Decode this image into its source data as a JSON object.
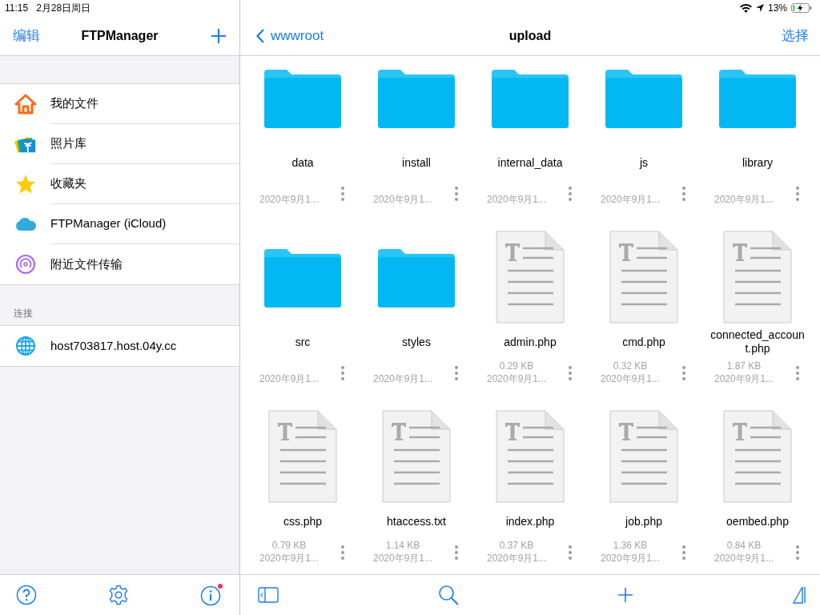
{
  "status_bar": {
    "time": "11:15",
    "date": "2月28日周日",
    "battery": {
      "text": "13%",
      "level": 0.13
    }
  },
  "sidebar": {
    "nav": {
      "edit": "编辑",
      "title": "FTPManager"
    },
    "items": [
      {
        "kind": "home",
        "label": "我的文件"
      },
      {
        "kind": "photos",
        "label": "照片库"
      },
      {
        "kind": "favorites",
        "label": "收藏夹"
      },
      {
        "kind": "cloud",
        "label": "FTPManager (iCloud)"
      },
      {
        "kind": "nearby",
        "label": "附近文件传输"
      }
    ],
    "section": "连接",
    "connections": [
      {
        "label": "host703817.host.04y.cc"
      }
    ],
    "info_notification": true
  },
  "main": {
    "nav": {
      "back": "wwwroot",
      "title": "upload",
      "select": "选择"
    },
    "files": [
      {
        "kind": "folder",
        "name": "data",
        "date": "2020年9月1..."
      },
      {
        "kind": "folder",
        "name": "install",
        "date": "2020年9月1..."
      },
      {
        "kind": "folder",
        "name": "internal_data",
        "date": "2020年9月1..."
      },
      {
        "kind": "folder",
        "name": "js",
        "date": "2020年9月1..."
      },
      {
        "kind": "folder",
        "name": "library",
        "date": "2020年9月1..."
      },
      {
        "kind": "folder",
        "name": "src",
        "date": "2020年9月1..."
      },
      {
        "kind": "folder",
        "name": "styles",
        "date": "2020年9月1..."
      },
      {
        "kind": "file",
        "name": "admin.php",
        "size": "0.29 KB",
        "date": "2020年9月1..."
      },
      {
        "kind": "file",
        "name": "cmd.php",
        "size": "0.32 KB",
        "date": "2020年9月1..."
      },
      {
        "kind": "file",
        "name": "connected_account.php",
        "size": "1.87 KB",
        "date": "2020年9月1..."
      },
      {
        "kind": "file",
        "name": "css.php",
        "size": "0.79 KB",
        "date": "2020年9月1..."
      },
      {
        "kind": "file",
        "name": "htaccess.txt",
        "size": "1.14 KB",
        "date": "2020年9月1..."
      },
      {
        "kind": "file",
        "name": "index.php",
        "size": "0.37 KB",
        "date": "2020年9月1..."
      },
      {
        "kind": "file",
        "name": "job.php",
        "size": "1.36 KB",
        "date": "2020年9月1..."
      },
      {
        "kind": "file",
        "name": "oembed.php",
        "size": "0.84 KB",
        "date": "2020年9月1..."
      }
    ]
  }
}
